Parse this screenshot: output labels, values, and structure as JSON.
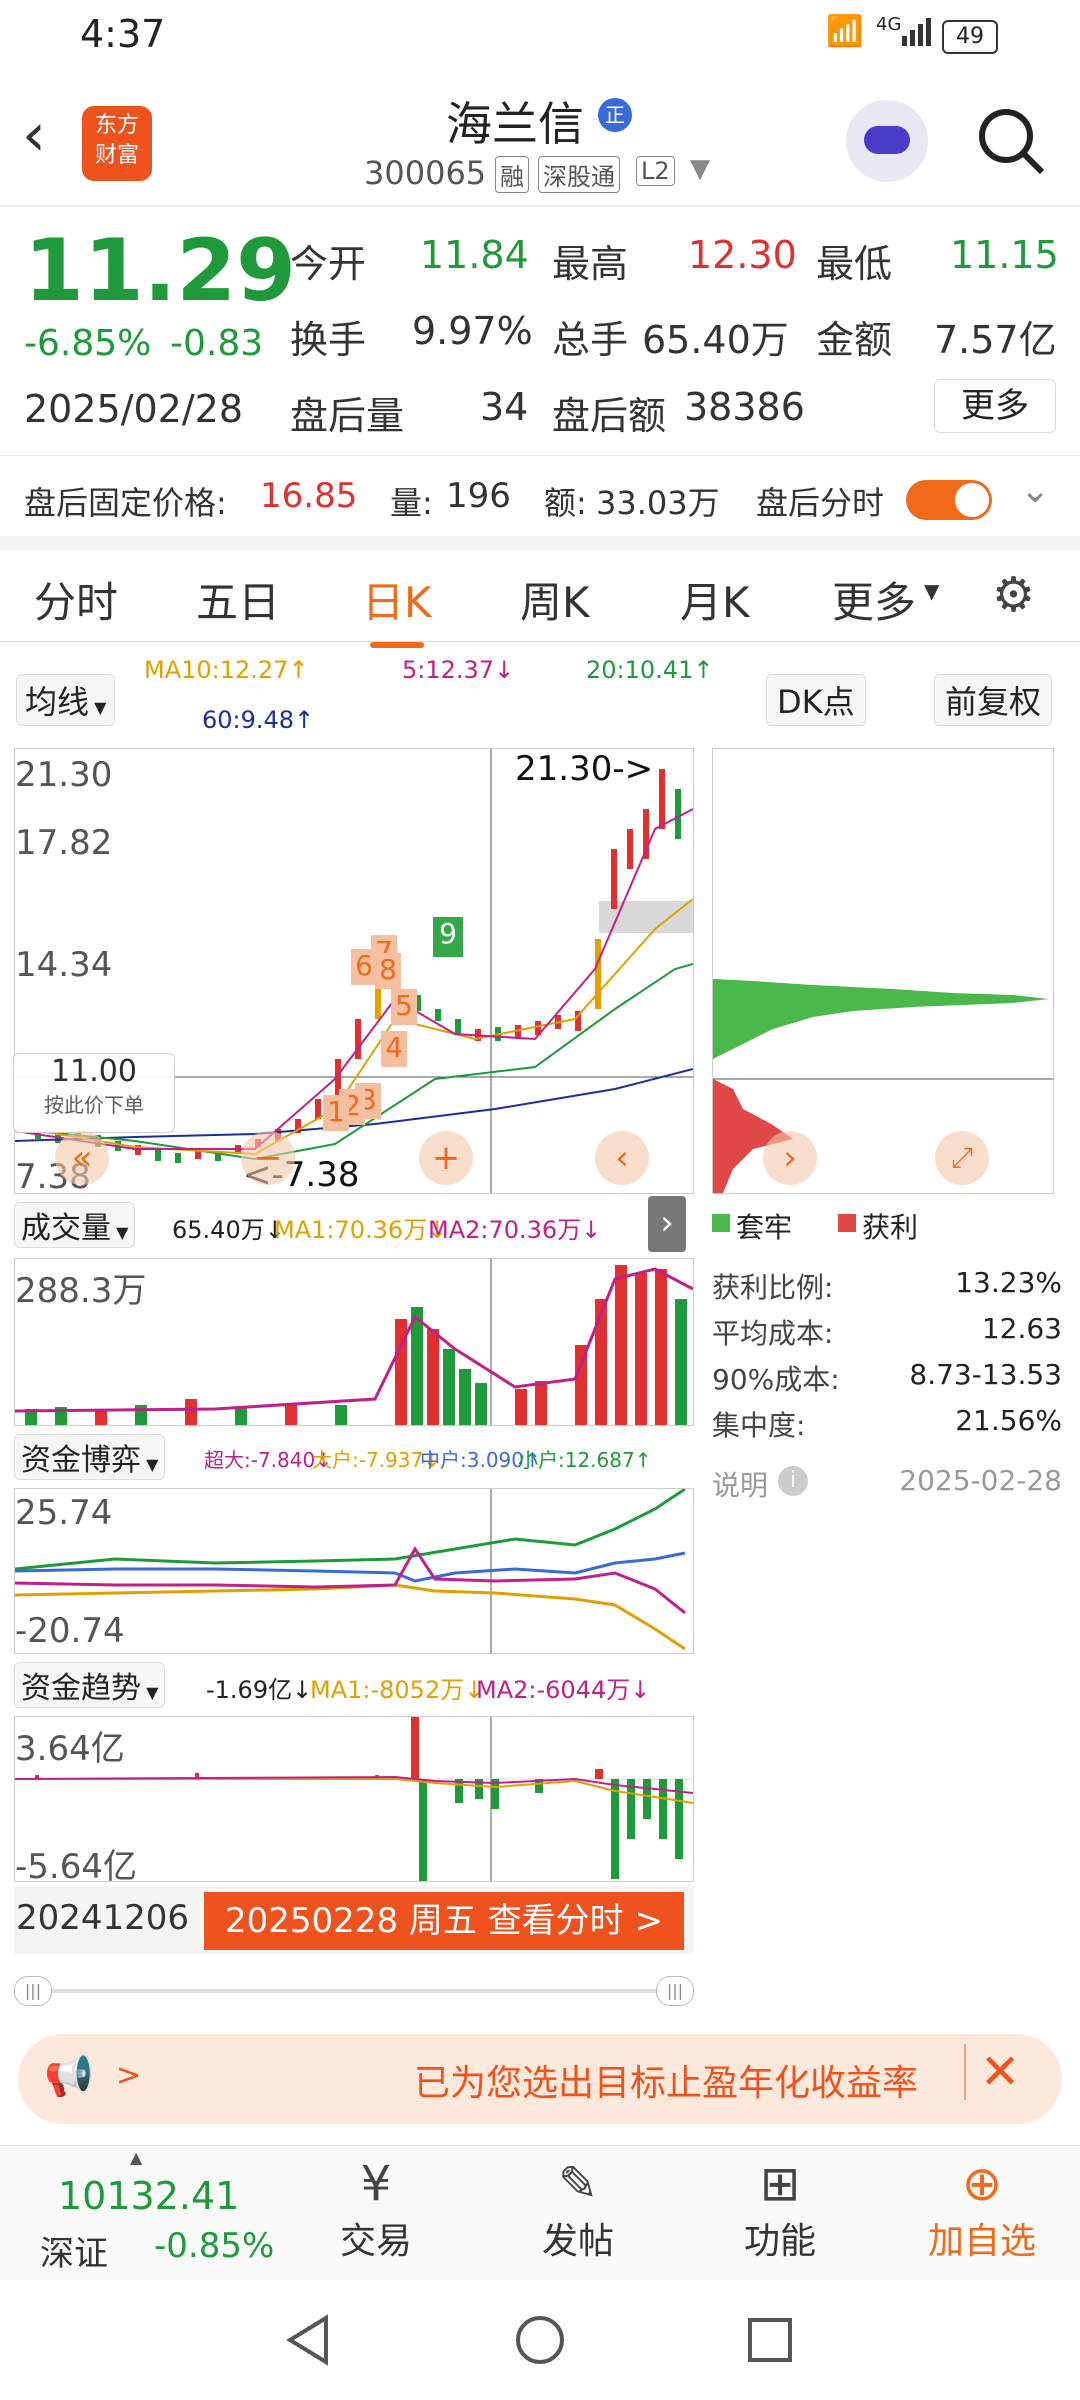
{
  "status": {
    "time": "4:37",
    "battery": "49",
    "signal": "4G"
  },
  "header": {
    "logo_line1": "东方",
    "logo_line2": "财富",
    "stock_name": "海兰信",
    "badge": "正",
    "code": "300065",
    "tags": [
      "融",
      "深股通",
      "L2"
    ]
  },
  "quote": {
    "price": "11.29",
    "change_pct": "-6.85%",
    "change": "-0.83",
    "date": "2025/02/28",
    "open_label": "今开",
    "open": "11.84",
    "high_label": "最高",
    "high": "12.30",
    "low_label": "最低",
    "low": "11.15",
    "turnover_label": "换手",
    "turnover": "9.97%",
    "volume_label": "总手",
    "volume": "65.40万",
    "amount_label": "金额",
    "amount": "7.57亿",
    "after_vol_label": "盘后量",
    "after_vol": "34",
    "after_amt_label": "盘后额",
    "after_amt": "38386",
    "more": "更多"
  },
  "afterhours": {
    "fixed_price_label": "盘后固定价格:",
    "fixed_price": "16.85",
    "vol_label": "量:",
    "vol": "196",
    "amt_label": "额:",
    "amt": "33.03万",
    "timeshare_label": "盘后分时"
  },
  "tabs": [
    "分时",
    "五日",
    "日K",
    "周K",
    "月K",
    "更多"
  ],
  "active_tab": "日K",
  "ma": {
    "selector": "均线",
    "ma10": "MA10:12.27↑",
    "ma5": "5:12.37↓",
    "ma20": "20:10.41↑",
    "ma60": "60:9.48↑",
    "dk": "DK点",
    "fq": "前复权"
  },
  "kline": {
    "y_top": "21.30",
    "y_2": "17.82",
    "y_3": "14.34",
    "y_bottom": "7.38",
    "peak_note": "21.30->",
    "low_note": "<-7.38",
    "order_price": "11.00",
    "order_hint": "按此价下单",
    "sequence_marks": [
      "1",
      "2",
      "3",
      "4",
      "5",
      "6",
      "7",
      "8",
      "9"
    ]
  },
  "chip": {
    "legend_trap": "套牢",
    "legend_profit": "获利",
    "rows": [
      {
        "label": "获利比例:",
        "value": "13.23%"
      },
      {
        "label": "平均成本:",
        "value": "12.63"
      },
      {
        "label": "90%成本:",
        "value": "8.73-13.53"
      },
      {
        "label": "集中度:",
        "value": "21.56%"
      }
    ],
    "note": "说明",
    "date": "2025-02-28"
  },
  "volume": {
    "selector": "成交量",
    "vol": "65.40万↓",
    "ma1": "MA1:70.36万↓",
    "ma2": "MA2:70.36万↓",
    "y_top": "288.3万"
  },
  "fund_game": {
    "selector": "资金博弈",
    "super": "超大:-7.840↓",
    "big": "大户:-7.937↓",
    "mid": "中户:3.090↑",
    "small": "小户:12.687↑",
    "y_top": "25.74",
    "y_bottom": "-20.74"
  },
  "fund_trend": {
    "selector": "资金趋势",
    "val": "-1.69亿↓",
    "ma1": "MA1:-8052万↓",
    "ma2": "MA2:-6044万↓",
    "y_top": "3.64亿",
    "y_bottom": "-5.64亿"
  },
  "timeline": {
    "start": "20241206",
    "current": "20250228 周五 查看分时 >"
  },
  "banner": {
    "text": "已为您选出目标止盈年化收益率"
  },
  "bottom": {
    "index_value": "10132.41",
    "index_name": "深证",
    "index_change": "-0.85%",
    "trade": "交易",
    "post": "发帖",
    "func": "功能",
    "add": "加自选"
  },
  "colors": {
    "up": "#e03030",
    "down": "#1e9a3a",
    "accent": "#f06a1a"
  }
}
